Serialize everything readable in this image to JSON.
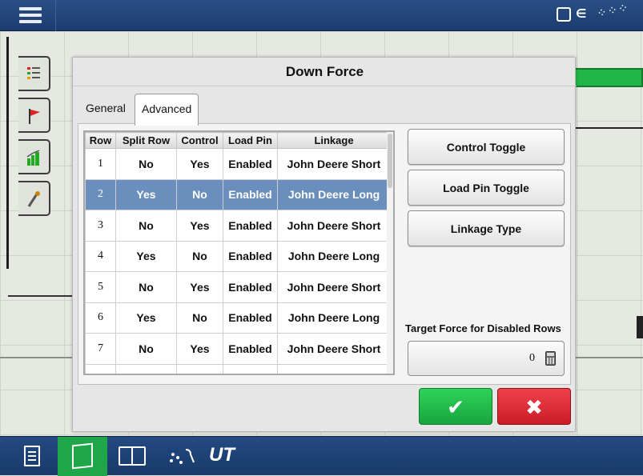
{
  "dialog": {
    "title": "Down Force",
    "tabs": [
      {
        "label": "General",
        "active": false
      },
      {
        "label": "Advanced",
        "active": true
      }
    ]
  },
  "table": {
    "columns": [
      "Row",
      "Split Row",
      "Control",
      "Load Pin",
      "Linkage"
    ],
    "rows": [
      {
        "row": "1",
        "split_row": "No",
        "control": "Yes",
        "load_pin": "Enabled",
        "linkage": "John Deere Short",
        "selected": false
      },
      {
        "row": "2",
        "split_row": "Yes",
        "control": "No",
        "load_pin": "Enabled",
        "linkage": "John Deere Long",
        "selected": true
      },
      {
        "row": "3",
        "split_row": "No",
        "control": "Yes",
        "load_pin": "Enabled",
        "linkage": "John Deere Short",
        "selected": false
      },
      {
        "row": "4",
        "split_row": "Yes",
        "control": "No",
        "load_pin": "Enabled",
        "linkage": "John Deere Long",
        "selected": false
      },
      {
        "row": "5",
        "split_row": "No",
        "control": "Yes",
        "load_pin": "Enabled",
        "linkage": "John Deere Short",
        "selected": false
      },
      {
        "row": "6",
        "split_row": "Yes",
        "control": "No",
        "load_pin": "Enabled",
        "linkage": "John Deere Long",
        "selected": false
      },
      {
        "row": "7",
        "split_row": "No",
        "control": "Yes",
        "load_pin": "Enabled",
        "linkage": "John Deere Short",
        "selected": false
      }
    ]
  },
  "buttons": {
    "control_toggle": "Control Toggle",
    "load_pin_toggle": "Load Pin Toggle",
    "linkage_type": "Linkage Type",
    "ok_glyph": "✔",
    "cancel_glyph": "✖"
  },
  "target_force": {
    "label": "Target Force for Disabled Rows",
    "value": "0"
  },
  "bottom_nav": {
    "ut_label": "UT"
  },
  "colors": {
    "selected_row": "#6b8fbd",
    "ok": "#1fbf4c",
    "cancel": "#e12a33",
    "topbar": "#234a82",
    "active_nav": "#1fa648"
  },
  "icons": [
    "menu-icon",
    "display-icon",
    "gps-icon",
    "signal-icon",
    "layers-icon",
    "flag-icon",
    "chart-icon",
    "wrench-icon",
    "calculator-icon",
    "document-icon",
    "map-icon",
    "split-screen-icon",
    "planter-icon"
  ]
}
